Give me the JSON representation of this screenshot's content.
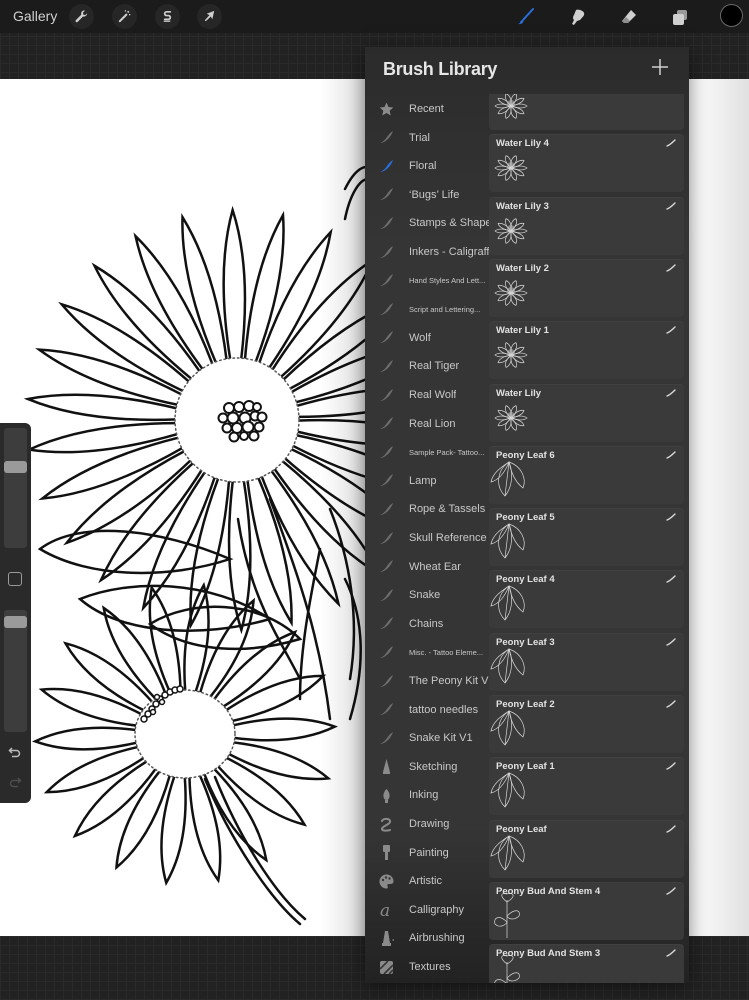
{
  "toolbar": {
    "gallery_label": "Gallery",
    "left_tools": [
      {
        "name": "actions",
        "icon": "wrench-icon"
      },
      {
        "name": "adjustments",
        "icon": "magic-wand-icon"
      },
      {
        "name": "selection",
        "icon": "selection-s-icon"
      },
      {
        "name": "transform",
        "icon": "arrow-cursor-icon"
      }
    ],
    "right_tools": [
      {
        "name": "brush",
        "icon": "brush-icon",
        "active": true
      },
      {
        "name": "smudge",
        "icon": "smudge-finger-icon",
        "active": false
      },
      {
        "name": "eraser",
        "icon": "eraser-icon",
        "active": false
      },
      {
        "name": "layers",
        "icon": "layers-icon",
        "active": false
      }
    ],
    "current_color": "#000000",
    "accent_color": "#2a6fdb"
  },
  "sidebar": {
    "brush_size_fraction": 0.12,
    "opacity_fraction": 0.05
  },
  "brush_library": {
    "title": "Brush Library",
    "add_label": "+",
    "categories": [
      {
        "label": "Recent",
        "icon": "star-icon"
      },
      {
        "label": "Trial",
        "icon": "brush-stroke-icon"
      },
      {
        "label": "Floral",
        "icon": "brush-stroke-icon",
        "active": true
      },
      {
        "label": "‘Bugs’ Life",
        "icon": "brush-stroke-icon"
      },
      {
        "label": "Stamps & Shapes",
        "icon": "brush-stroke-icon"
      },
      {
        "label": "Inkers - Caligraff",
        "icon": "brush-stroke-icon"
      },
      {
        "label": "Hand Styles And Lett...",
        "icon": "brush-stroke-icon",
        "small": true
      },
      {
        "label": "Script and Lettering...",
        "icon": "brush-stroke-icon",
        "small": true
      },
      {
        "label": "Wolf",
        "icon": "brush-stroke-icon"
      },
      {
        "label": "Real Tiger",
        "icon": "brush-stroke-icon"
      },
      {
        "label": "Real Wolf",
        "icon": "brush-stroke-icon"
      },
      {
        "label": "Real Lion",
        "icon": "brush-stroke-icon"
      },
      {
        "label": "Sample Pack- Tattoo...",
        "icon": "brush-stroke-icon",
        "small": true
      },
      {
        "label": "Lamp",
        "icon": "brush-stroke-icon"
      },
      {
        "label": "Rope & Tassels",
        "icon": "brush-stroke-icon"
      },
      {
        "label": "Skull Reference",
        "icon": "brush-stroke-icon"
      },
      {
        "label": "Wheat Ear",
        "icon": "brush-stroke-icon"
      },
      {
        "label": "Snake",
        "icon": "brush-stroke-icon"
      },
      {
        "label": "Chains",
        "icon": "brush-stroke-icon"
      },
      {
        "label": "Misc. - Tattoo Eleme...",
        "icon": "brush-stroke-icon",
        "small": true
      },
      {
        "label": "The Peony Kit V1",
        "icon": "brush-stroke-icon"
      },
      {
        "label": "tattoo needles",
        "icon": "brush-stroke-icon"
      },
      {
        "label": "Snake Kit V1",
        "icon": "brush-stroke-icon"
      },
      {
        "label": "Sketching",
        "icon": "pencil-tip-icon"
      },
      {
        "label": "Inking",
        "icon": "pen-nib-icon"
      },
      {
        "label": "Drawing",
        "icon": "squiggle-icon"
      },
      {
        "label": "Painting",
        "icon": "paint-brush-icon"
      },
      {
        "label": "Artistic",
        "icon": "palette-icon"
      },
      {
        "label": "Calligraphy",
        "icon": "calligraphy-a-icon"
      },
      {
        "label": "Airbrushing",
        "icon": "airbrush-icon"
      },
      {
        "label": "Textures",
        "icon": "texture-icon"
      }
    ],
    "brushes": [
      {
        "name": "",
        "preview": "lily"
      },
      {
        "name": "Water Lily 4",
        "preview": "lily"
      },
      {
        "name": "Water Lily 3",
        "preview": "lily"
      },
      {
        "name": "Water Lily 2",
        "preview": "lily"
      },
      {
        "name": "Water Lily 1",
        "preview": "lily"
      },
      {
        "name": "Water Lily",
        "preview": "lily"
      },
      {
        "name": "Peony Leaf 6",
        "preview": "leaf"
      },
      {
        "name": "Peony Leaf 5",
        "preview": "leaf"
      },
      {
        "name": "Peony Leaf 4",
        "preview": "leaf"
      },
      {
        "name": "Peony Leaf 3",
        "preview": "leaf"
      },
      {
        "name": "Peony Leaf 2",
        "preview": "leaf"
      },
      {
        "name": "Peony Leaf 1",
        "preview": "leaf"
      },
      {
        "name": "Peony Leaf",
        "preview": "leaf"
      },
      {
        "name": "Peony Bud And Stem 4",
        "preview": "bud"
      },
      {
        "name": "Peony Bud And Stem 3",
        "preview": "bud"
      }
    ]
  }
}
